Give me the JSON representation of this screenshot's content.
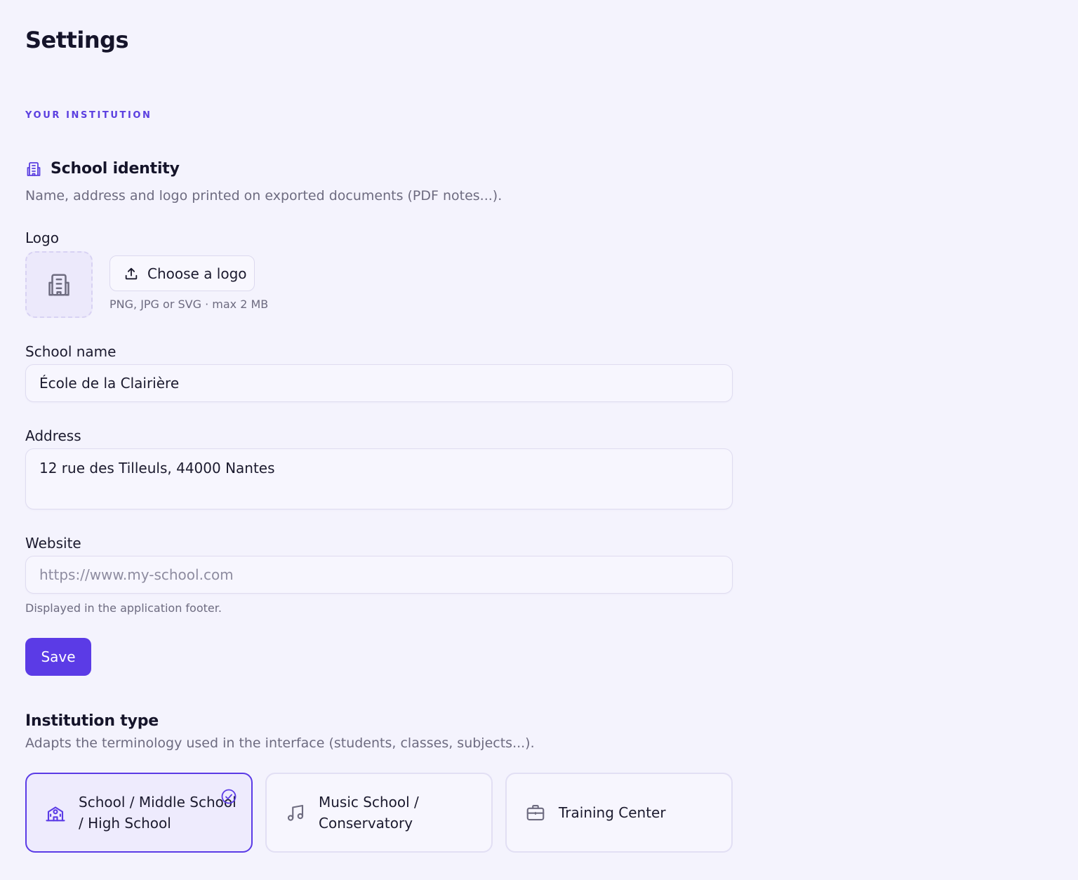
{
  "page": {
    "title": "Settings"
  },
  "section": {
    "eyebrow": "YOUR INSTITUTION"
  },
  "identity": {
    "icon": "building-icon",
    "title": "School identity",
    "description": "Name, address and logo printed on exported documents (PDF notes...).",
    "logo": {
      "label": "Logo",
      "placeholder_icon": "building-icon",
      "button_icon": "upload-icon",
      "button_label": "Choose a logo",
      "hint": "PNG, JPG or SVG · max 2 MB"
    },
    "school_name": {
      "label": "School name",
      "value": "École de la Clairière"
    },
    "address": {
      "label": "Address",
      "value": "12 rue des Tilleuls, 44000 Nantes"
    },
    "website": {
      "label": "Website",
      "value": "",
      "placeholder": "https://www.my-school.com",
      "hint": "Displayed in the application footer."
    },
    "save_label": "Save"
  },
  "institution_type": {
    "title": "Institution type",
    "description": "Adapts the terminology used in the interface (students, classes, subjects...).",
    "options": [
      {
        "label": "School / Middle School / High School",
        "icon": "school-icon",
        "selected": true
      },
      {
        "label": "Music School / Conservatory",
        "icon": "music-note-icon",
        "selected": false
      },
      {
        "label": "Training Center",
        "icon": "briefcase-icon",
        "selected": false
      }
    ],
    "selected_indicator_icon": "check-circle-icon"
  },
  "colors": {
    "accent": "#5b3be6",
    "background": "#f4f3fd",
    "muted_text": "#6d6b80"
  }
}
